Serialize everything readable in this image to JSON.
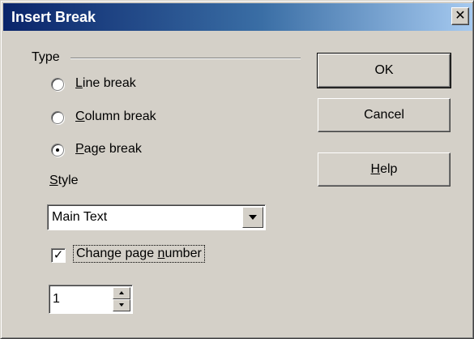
{
  "window": {
    "title": "Insert Break",
    "close_glyph": "✕",
    "close_icon": "close-icon"
  },
  "type_group": {
    "label": "Type",
    "options": [
      {
        "mnemonic": "L",
        "rest": "ine break",
        "selected": false
      },
      {
        "mnemonic": "C",
        "rest": "olumn break",
        "selected": false
      },
      {
        "mnemonic": "P",
        "rest": "age break",
        "selected": true
      }
    ]
  },
  "style": {
    "label_mnemonic": "S",
    "label_rest": "tyle",
    "selected_value": "Main Text",
    "dropdown_icon": "chevron-down-icon"
  },
  "change_page_number": {
    "checked": true,
    "label_before": "Change page ",
    "label_mnemonic": "n",
    "label_after": "umber",
    "check_glyph": "✓"
  },
  "page_number": {
    "value": "1",
    "up_icon": "arrow-up-icon",
    "down_icon": "arrow-down-icon"
  },
  "buttons": {
    "ok": "OK",
    "cancel": "Cancel",
    "help_mnemonic": "H",
    "help_rest": "elp"
  }
}
